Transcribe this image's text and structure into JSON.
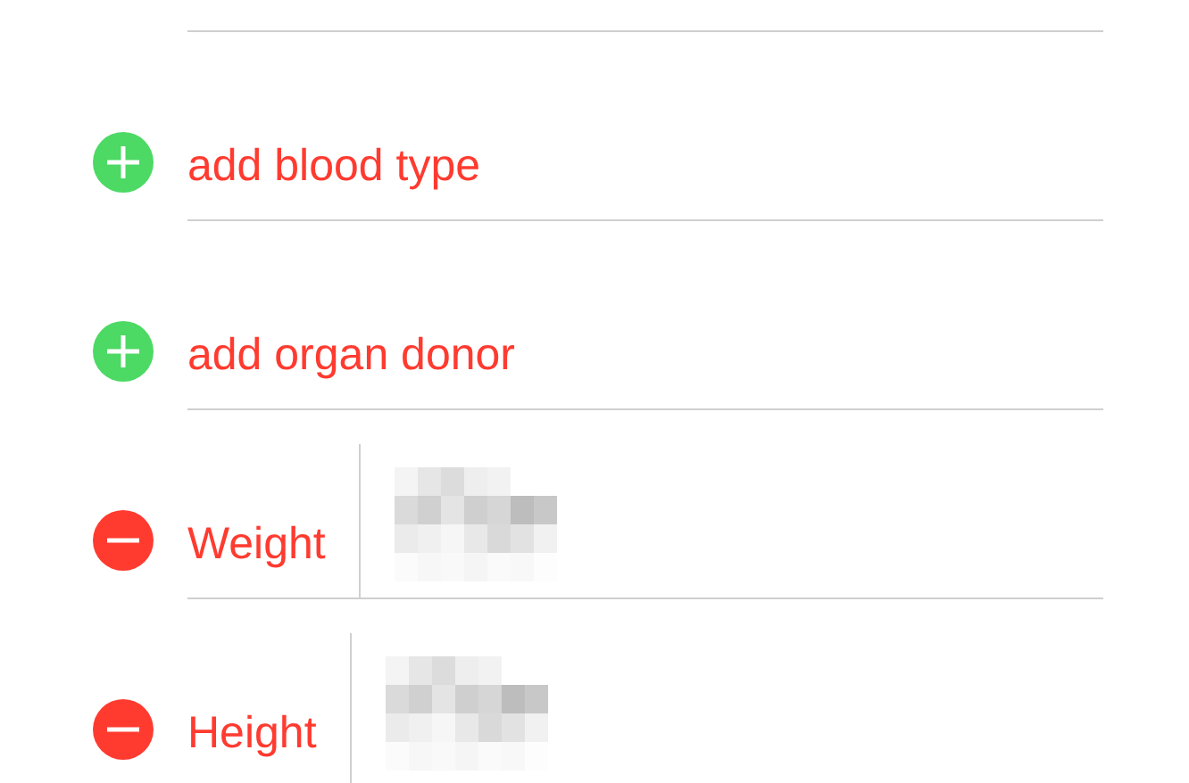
{
  "rows": [
    {
      "kind": "add",
      "label": "add blood type"
    },
    {
      "kind": "add",
      "label": "add organ donor"
    },
    {
      "kind": "remove",
      "label": "Weight",
      "redacted": true
    },
    {
      "kind": "remove",
      "label": "Height",
      "redacted": true
    }
  ]
}
